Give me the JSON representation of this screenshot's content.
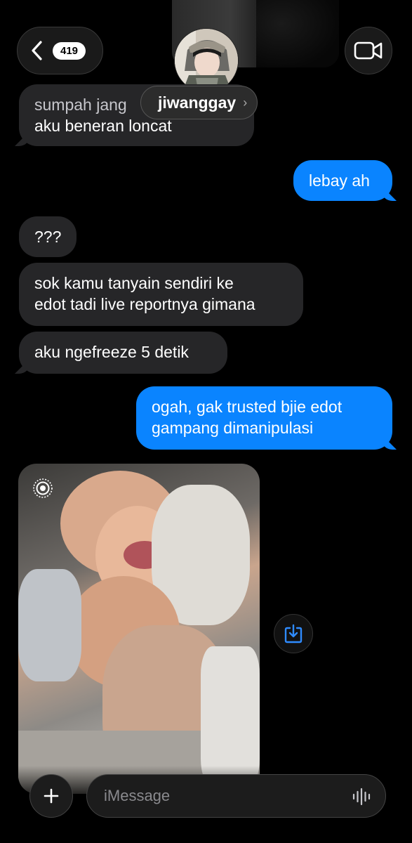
{
  "header": {
    "back_count": "419",
    "contact_name": "jiwanggay",
    "chevron": "›"
  },
  "messages": [
    {
      "dir": "in",
      "lines": [
        "sumpah jang",
        "aku beneran loncat"
      ]
    },
    {
      "dir": "out",
      "lines": [
        "lebay ah"
      ]
    },
    {
      "dir": "in",
      "lines": [
        "???"
      ]
    },
    {
      "dir": "in",
      "lines": [
        "sok kamu tanyain sendiri ke",
        "edot tadi live reportnya gimana"
      ]
    },
    {
      "dir": "in",
      "lines": [
        "aku ngefreeze 5 detik"
      ]
    },
    {
      "dir": "out",
      "lines": [
        "ogah, gak trusted bjie edot",
        "gampang dimanipulasi"
      ]
    }
  ],
  "composer": {
    "placeholder": "iMessage"
  },
  "icons": {
    "back": "chevron-left-icon",
    "video": "video-camera-icon",
    "live_photo": "live-photo-icon",
    "save": "download-icon",
    "plus": "plus-icon",
    "audio": "waveform-icon"
  },
  "colors": {
    "outgoing": "#0a84ff",
    "incoming": "#262628",
    "background": "#000000"
  }
}
